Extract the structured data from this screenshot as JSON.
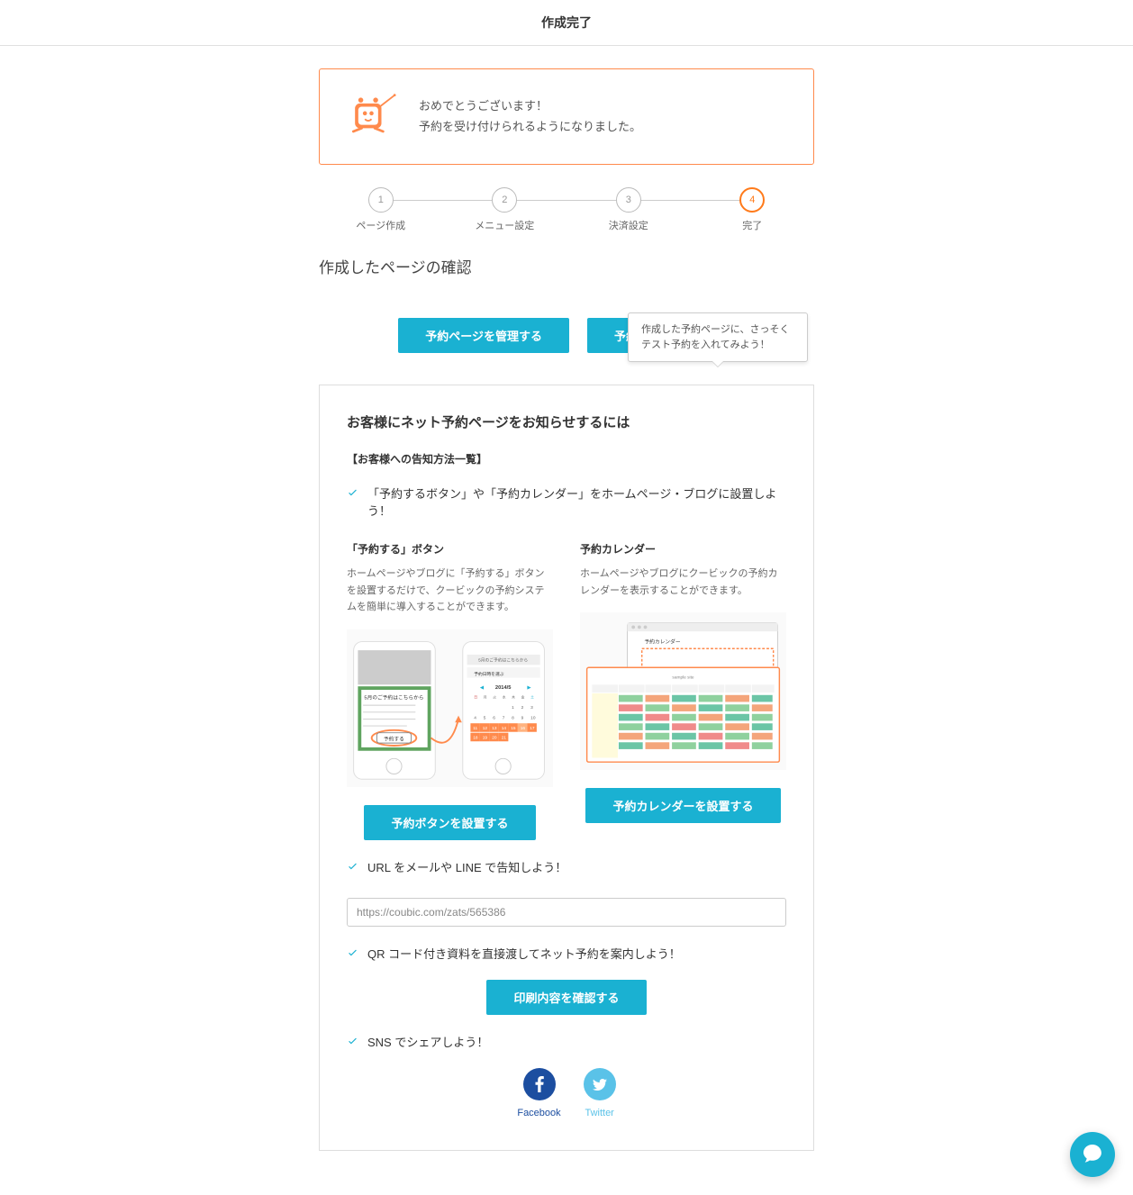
{
  "page_title": "作成完了",
  "congrats": {
    "line1": "おめでとうございます！",
    "line2": "予約を受け付けられるようになりました。"
  },
  "steps": [
    {
      "num": "1",
      "label": "ページ作成"
    },
    {
      "num": "2",
      "label": "メニュー設定"
    },
    {
      "num": "3",
      "label": "決済設定"
    },
    {
      "num": "4",
      "label": "完了"
    }
  ],
  "section_heading": "作成したページの確認",
  "tooltip": "作成した予約ページに、さっそくテスト予約を入れてみよう！",
  "buttons": {
    "manage": "予約ページを管理する",
    "view": "予約ページを見る",
    "set_button": "予約ボタンを設置する",
    "set_calendar": "予約カレンダーを設置する",
    "print": "印刷内容を確認する"
  },
  "panel": {
    "title": "お客様にネット予約ページをお知らせするには",
    "subtitle": "【お客様への告知方法一覧】",
    "check1": "「予約するボタン」や「予約カレンダー」をホームページ・ブログに設置しよう！",
    "button_col": {
      "title": "「予約する」ボタン",
      "desc": "ホームページやブログに「予約する」ボタンを設置するだけで、クービックの予約システムを簡単に導入することができます。"
    },
    "calendar_col": {
      "title": "予約カレンダー",
      "desc": "ホームページやブログにクービックの予約カレンダーを表示することができます。"
    },
    "check2": "URL をメールや LINE で告知しよう！",
    "url_value": "https://coubic.com/zats/565386",
    "check3": "QR コード付き資料を直接渡してネット予約を案内しよう！",
    "check4": "SNS でシェアしよう！"
  },
  "social": {
    "facebook": "Facebook",
    "twitter": "Twitter"
  },
  "illustrations": {
    "phone_header": "5月のご予約はこちらから",
    "phone_btn": "予約する",
    "phone_cal_header": "5月のご予約はこちらから",
    "phone_cal_sub": "予約日時を選ぶ",
    "phone_cal_month": "2014/5",
    "cal_title": "予約カレンダー"
  }
}
